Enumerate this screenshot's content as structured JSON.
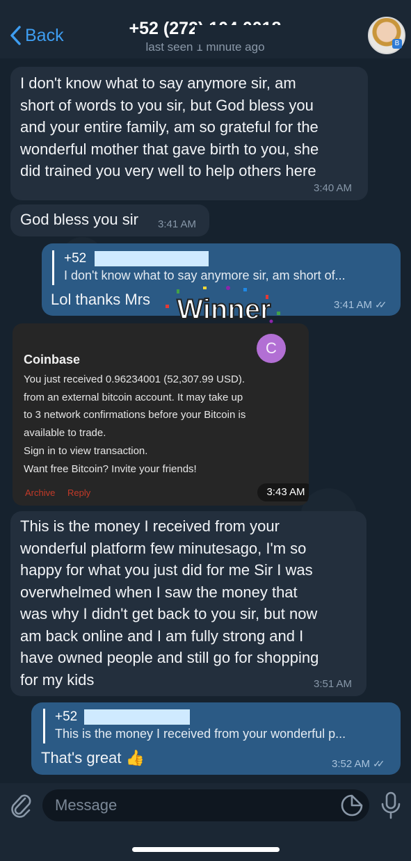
{
  "header": {
    "back_label": "Back",
    "title": "+52 (272) 104 0018",
    "subtitle": "last seen 1 minute ago",
    "avatar_badge": "B"
  },
  "messages": [
    {
      "direction": "incoming",
      "text": "I don't know what to say anymore sir, am short of words to you sir, but God bless you and your entire family, am so grateful for the wonderful mother that gave birth to you, she did trained you very well to help others here",
      "lines": [
        "I don't know what to say anymore sir, am",
        "short of words to you sir, but God bless you",
        "and your entire family, am so grateful for the",
        "wonderful mother that gave birth to you, she",
        "did trained you very well to help others here"
      ],
      "time": "3:40 AM"
    },
    {
      "direction": "incoming",
      "text": "God bless you sir",
      "time": "3:41 AM"
    },
    {
      "direction": "outgoing",
      "reply_name": "+52",
      "reply_text": "I don't know what to say anymore sir, am short of...",
      "text": "Lol thanks Mrs",
      "time": "3:41 AM"
    },
    {
      "direction": "incoming",
      "type": "screenshot",
      "card": {
        "app_name": "Coinbase",
        "avatar_letter": "C",
        "lines": [
          "You just received 0.96234001 (52,307.99 USD).",
          "from an external bitcoin account. It may take up",
          "to 3 network confirmations before your Bitcoin is",
          "available to trade.",
          "Sign in to view transaction.",
          "Want free Bitcoin? Invite your friends!"
        ],
        "actions": [
          "Archive",
          "Reply"
        ]
      },
      "time": "3:43 AM"
    },
    {
      "direction": "incoming",
      "text": "This is the money I received from your wonderful platform few minutesago, I'm so happy for what you just did for me Sir I was overwhelmed when I saw the money that was why I didn't get back to you sir, but now am back online and I am fully strong and I have owned people and still go for shopping for my kids",
      "lines": [
        "This is the money I received from your",
        "wonderful platform few minutesago, I'm so",
        "happy for what you just did for me Sir I was",
        "overwhelmed when I saw the money that",
        "was why I didn't get back to you sir, but now",
        "am back online and I am fully strong and I",
        "have owned people and still go for shopping",
        "for my kids"
      ],
      "time": "3:51 AM"
    },
    {
      "direction": "outgoing",
      "reply_name": "+52",
      "reply_text": "This is the money I received from your wonderful p...",
      "text": "That's great",
      "emoji": "👍",
      "time": "3:52 AM"
    }
  ],
  "sticker": {
    "label": "Winner"
  },
  "input": {
    "placeholder": "Message"
  },
  "icons": {
    "back": "chevron-left-icon",
    "attach": "paperclip-icon",
    "sticker": "sticker-icon",
    "mic": "microphone-icon",
    "read": "double-check-icon"
  },
  "colors": {
    "accent": "#3e9df0",
    "incoming_bubble": "#232f3d",
    "outgoing_bubble": "#2b5a85",
    "coinbase_avatar": "#b26fd4"
  }
}
